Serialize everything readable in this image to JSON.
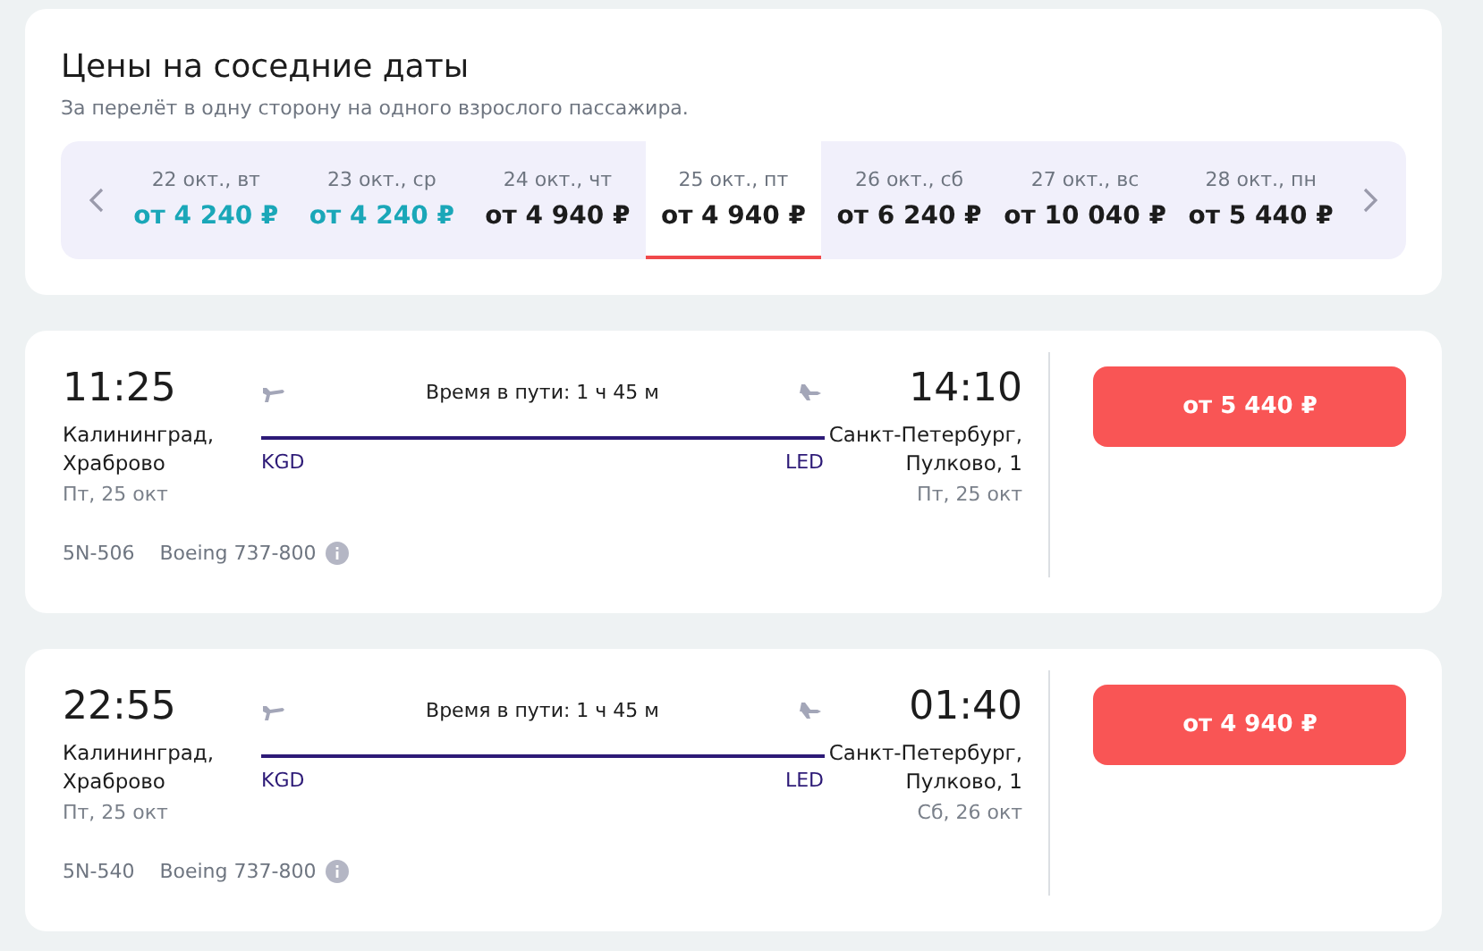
{
  "nearby_dates": {
    "title": "Цены на соседние даты",
    "subtitle": "За перелёт в одну сторону на одного взрослого пассажира.",
    "dates": [
      {
        "date": "22 окт., вт",
        "price": "от 4 240 ₽",
        "lowest": true,
        "selected": false
      },
      {
        "date": "23 окт., ср",
        "price": "от 4 240 ₽",
        "lowest": true,
        "selected": false
      },
      {
        "date": "24 окт., чт",
        "price": "от 4 940 ₽",
        "lowest": false,
        "selected": false
      },
      {
        "date": "25 окт., пт",
        "price": "от 4 940 ₽",
        "lowest": false,
        "selected": true
      },
      {
        "date": "26 окт., сб",
        "price": "от 6 240 ₽",
        "lowest": false,
        "selected": false
      },
      {
        "date": "27 окт., вс",
        "price": "от 10 040 ₽",
        "lowest": false,
        "selected": false
      },
      {
        "date": "28 окт., пн",
        "price": "от 5 440 ₽",
        "lowest": false,
        "selected": false
      }
    ]
  },
  "flights": [
    {
      "depart_time": "11:25",
      "depart_city": "Калининград,",
      "depart_airport": "Храброво",
      "depart_date": "Пт, 25 окт",
      "duration": "Время в пути: 1 ч 45 м",
      "from_code": "KGD",
      "to_code": "LED",
      "arrive_time": "14:10",
      "arrive_city": "Санкт-Петербург,",
      "arrive_airport": "Пулково, 1",
      "arrive_date": "Пт, 25 окт",
      "flight_number": "5N-506",
      "aircraft": "Boeing 737-800",
      "price": "от 5 440 ₽"
    },
    {
      "depart_time": "22:55",
      "depart_city": "Калининград,",
      "depart_airport": "Храброво",
      "depart_date": "Пт, 25 окт",
      "duration": "Время в пути: 1 ч 45 м",
      "from_code": "KGD",
      "to_code": "LED",
      "arrive_time": "01:40",
      "arrive_city": "Санкт-Петербург,",
      "arrive_airport": "Пулково, 1",
      "arrive_date": "Сб, 26 окт",
      "flight_number": "5N-540",
      "aircraft": "Boeing 737-800",
      "price": "от 4 940 ₽"
    }
  ]
}
